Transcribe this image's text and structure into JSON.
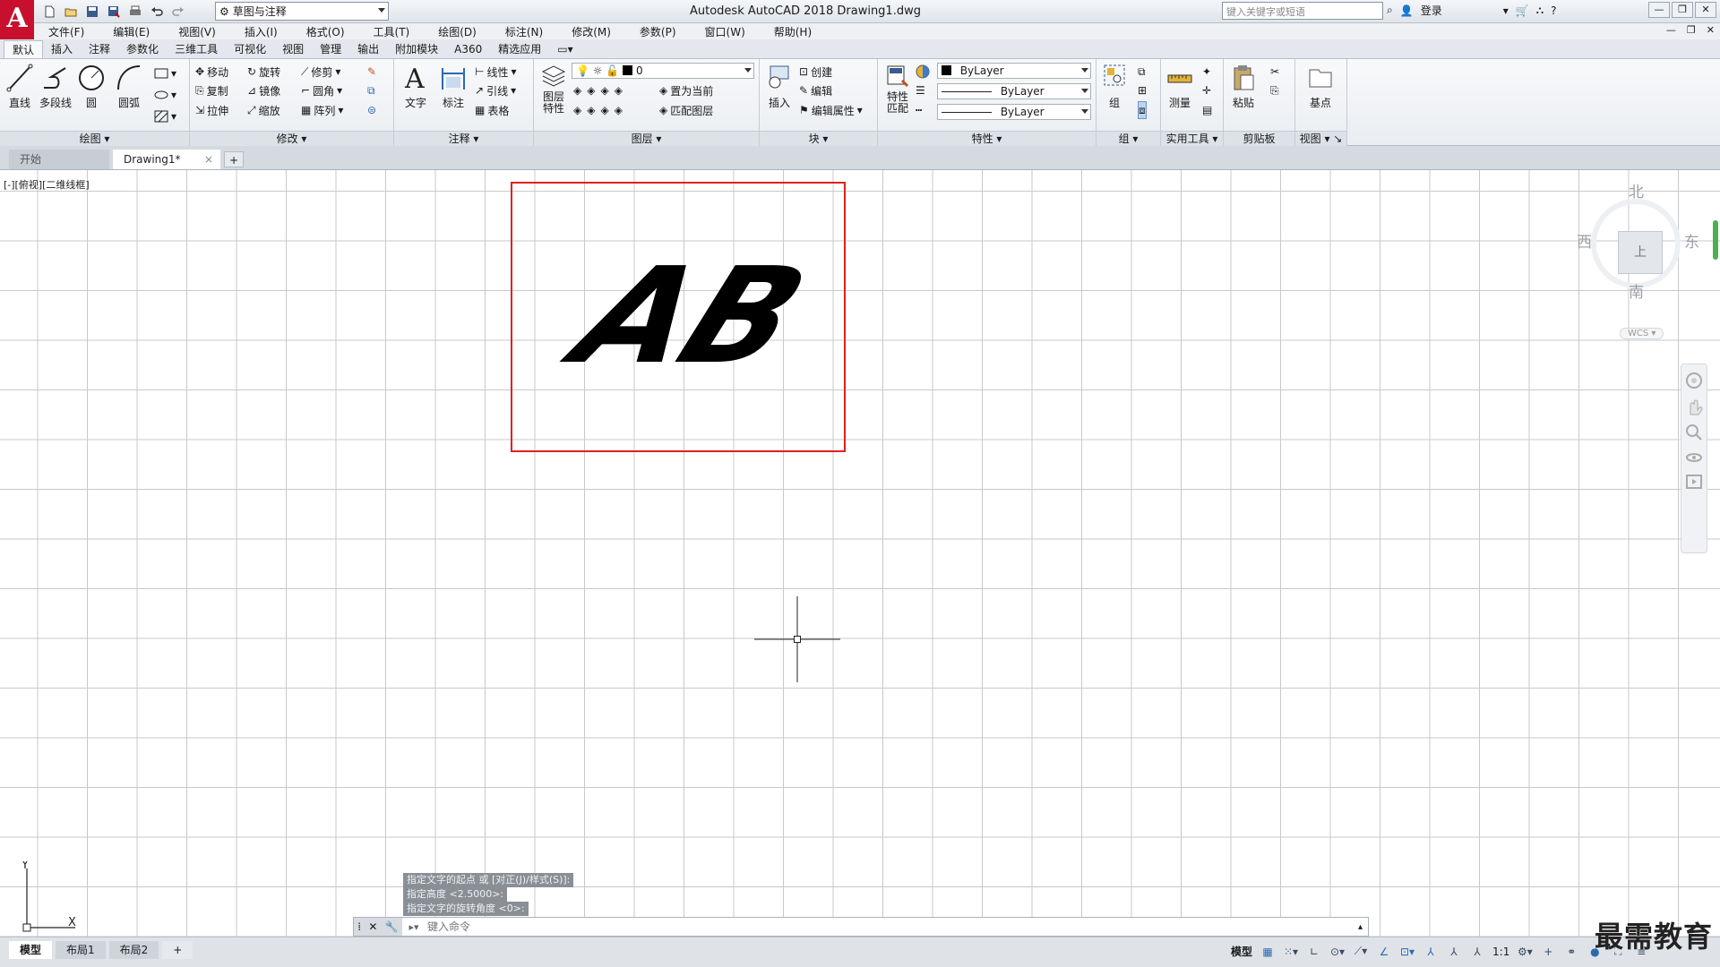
{
  "app": {
    "logo_letter": "A",
    "window_title": "Autodesk AutoCAD 2018    Drawing1.dwg",
    "workspace": "草图与注释",
    "search_placeholder": "键入关键字或短语",
    "login_label": "登录",
    "brand_color": "#c8102e"
  },
  "window_controls": {
    "minimize": "—",
    "restore": "❐",
    "close": "✕"
  },
  "menubar": {
    "items": [
      "文件(F)",
      "编辑(E)",
      "视图(V)",
      "插入(I)",
      "格式(O)",
      "工具(T)",
      "绘图(D)",
      "标注(N)",
      "修改(M)",
      "参数(P)",
      "窗口(W)",
      "帮助(H)"
    ],
    "mdi_controls": [
      "—",
      "❐",
      "✕"
    ]
  },
  "ribbon_tabs": [
    "默认",
    "插入",
    "注释",
    "参数化",
    "三维工具",
    "可视化",
    "视图",
    "管理",
    "输出",
    "附加模块",
    "A360",
    "精选应用"
  ],
  "ribbon_active_tab": "默认",
  "ribbon": {
    "draw": {
      "title": "绘图",
      "line": "直线",
      "polyline": "多段线",
      "circle": "圆",
      "arc": "圆弧"
    },
    "modify": {
      "title": "修改",
      "move": "移动",
      "rotate": "旋转",
      "trim": "修剪",
      "copy": "复制",
      "mirror": "镜像",
      "fillet": "圆角",
      "stretch": "拉伸",
      "scale": "缩放",
      "array": "阵列"
    },
    "annotation": {
      "title": "注释",
      "text": "文字",
      "dimension": "标注",
      "linear": "线性",
      "leader": "引线",
      "table": "表格"
    },
    "layers": {
      "title": "图层",
      "layer_props_1": "图层",
      "layer_props_2": "特性",
      "current_layer": "0",
      "set_current": "置为当前",
      "match_layer": "匹配图层",
      "layer_color": "#000000"
    },
    "block": {
      "title": "块",
      "insert": "插入",
      "create": "创建",
      "edit": "编辑",
      "edit_attr": "编辑属性"
    },
    "properties": {
      "title": "特性",
      "match_1": "特性",
      "match_2": "匹配",
      "color": "ByLayer",
      "linetype": "ByLayer",
      "lineweight": "ByLayer"
    },
    "groups": {
      "title": "组",
      "group": "组"
    },
    "utilities": {
      "title": "实用工具",
      "measure": "测量"
    },
    "clipboard": {
      "title": "剪贴板",
      "paste": "粘贴"
    },
    "view": {
      "title": "视图",
      "base": "基点"
    }
  },
  "doc_tabs": {
    "start": "开始",
    "drawing": "Drawing1*",
    "close": "×",
    "add": "+"
  },
  "viewport": {
    "label": "[-][俯视][二维线框]",
    "drawing_text": "AB",
    "frame_color": "#e02020"
  },
  "viewcube": {
    "north": "北",
    "south": "南",
    "east": "东",
    "west": "西",
    "face": "上",
    "wcs": "WCS"
  },
  "ucs": {
    "y": "Y",
    "x": "X"
  },
  "command": {
    "history": [
      "指定文字的起点 或 [对正(J)/样式(S)]:",
      "指定高度 <2.5000>:",
      "指定文字的旋转角度 <0>:"
    ],
    "placeholder": "键入命令"
  },
  "statusbar": {
    "layout_tabs": [
      "模型",
      "布局1",
      "布局2"
    ],
    "add_layout": "+",
    "model_label": "模型",
    "scale": "1:1",
    "watermark": "最需教育"
  }
}
